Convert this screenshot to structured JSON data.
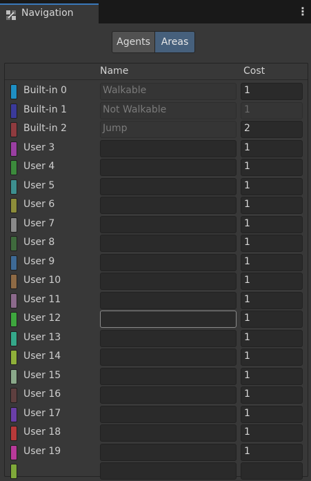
{
  "window": {
    "tab_title": "Navigation",
    "tab_icon": "navigation-icon",
    "menu_icon": "more-vertical-icon"
  },
  "toolbar": {
    "tabs": [
      {
        "label": "Agents",
        "selected": false
      },
      {
        "label": "Areas",
        "selected": true
      }
    ]
  },
  "table": {
    "columns": {
      "name": "Name",
      "cost": "Cost"
    },
    "rows": [
      {
        "label": "Built-in 0",
        "color": "#1e8fc4",
        "name": "Walkable",
        "cost": "1",
        "name_readonly": true,
        "cost_disabled": false
      },
      {
        "label": "Built-in 1",
        "color": "#3b3a9a",
        "name": "Not Walkable",
        "cost": "1",
        "name_readonly": true,
        "cost_disabled": true
      },
      {
        "label": "Built-in 2",
        "color": "#8f3b3f",
        "name": "Jump",
        "cost": "2",
        "name_readonly": true,
        "cost_disabled": false
      },
      {
        "label": "User 3",
        "color": "#9a3fa2",
        "name": "",
        "cost": "1"
      },
      {
        "label": "User 4",
        "color": "#3c8a3c",
        "name": "",
        "cost": "1"
      },
      {
        "label": "User 5",
        "color": "#3d8f8f",
        "name": "",
        "cost": "1"
      },
      {
        "label": "User 6",
        "color": "#8d8d3a",
        "name": "",
        "cost": "1"
      },
      {
        "label": "User 7",
        "color": "#8a8a8a",
        "name": "",
        "cost": "1"
      },
      {
        "label": "User 8",
        "color": "#3f6a3d",
        "name": "",
        "cost": "1"
      },
      {
        "label": "User 9",
        "color": "#3e6a96",
        "name": "",
        "cost": "1"
      },
      {
        "label": "User 10",
        "color": "#8e6a45",
        "name": "",
        "cost": "1"
      },
      {
        "label": "User 11",
        "color": "#8c6a8c",
        "name": "",
        "cost": "1"
      },
      {
        "label": "User 12",
        "color": "#3ea63e",
        "name": "",
        "cost": "1",
        "focused": true
      },
      {
        "label": "User 13",
        "color": "#35a88a",
        "name": "",
        "cost": "1"
      },
      {
        "label": "User 14",
        "color": "#8fb03a",
        "name": "",
        "cost": "1"
      },
      {
        "label": "User 15",
        "color": "#8aa88a",
        "name": "",
        "cost": "1"
      },
      {
        "label": "User 16",
        "color": "#5e3f3f",
        "name": "",
        "cost": "1"
      },
      {
        "label": "User 17",
        "color": "#6a3fa8",
        "name": "",
        "cost": "1"
      },
      {
        "label": "User 18",
        "color": "#b83a3a",
        "name": "",
        "cost": "1"
      },
      {
        "label": "User 19",
        "color": "#b83a9a",
        "name": "",
        "cost": "1"
      },
      {
        "label": "",
        "color": "#7fa83a",
        "name": "",
        "cost": ""
      }
    ]
  }
}
